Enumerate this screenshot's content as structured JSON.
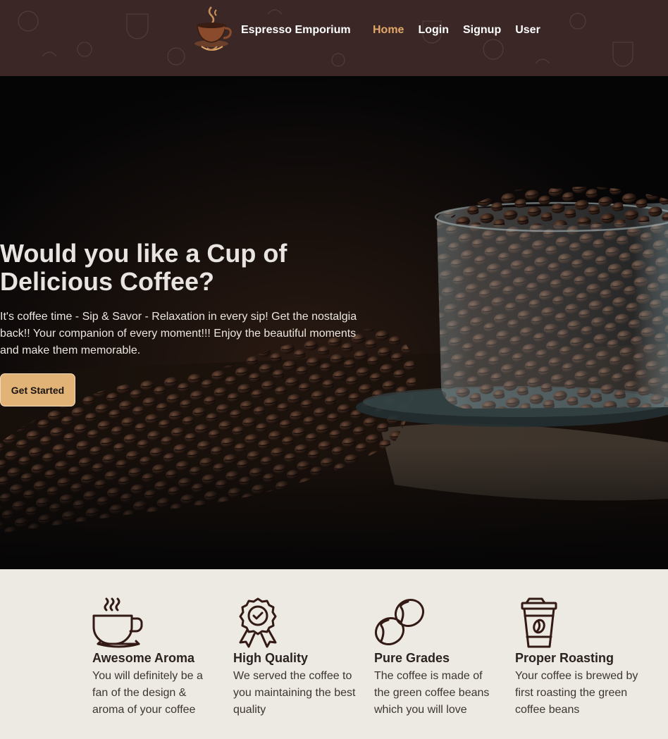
{
  "nav": {
    "brand": "Espresso Emporium",
    "links": [
      {
        "label": "Home",
        "active": true
      },
      {
        "label": "Login",
        "active": false
      },
      {
        "label": "Signup",
        "active": false
      },
      {
        "label": "User",
        "active": false
      }
    ]
  },
  "hero": {
    "title_line1": "Would you like a Cup of",
    "title_line2": "Delicious Coffee?",
    "text": "It's coffee time - Sip & Savor - Relaxation in every sip! Get the nostalgia back!! Your companion of every moment!!! Enjoy the beautiful moments and make them memorable.",
    "cta_label": "Get Started"
  },
  "features": [
    {
      "icon": "coffee-cup-icon",
      "title": "Awesome Aroma",
      "text": "You will definitely be a fan of the design & aroma of your coffee"
    },
    {
      "icon": "quality-badge-icon",
      "title": "High Quality",
      "text": "We served the coffee to you maintaining the best quality"
    },
    {
      "icon": "coffee-beans-icon",
      "title": "Pure Grades",
      "text": "The coffee is made of the green coffee beans which you will love"
    },
    {
      "icon": "takeaway-cup-icon",
      "title": "Proper Roasting",
      "text": "Your coffee is brewed by first roasting the green coffee beans"
    }
  ],
  "colors": {
    "nav_bg": "#3a2726",
    "accent": "#e3a869",
    "button_bg": "#e1b377",
    "features_bg": "#ede9e3",
    "icon_stroke": "#331a15"
  }
}
